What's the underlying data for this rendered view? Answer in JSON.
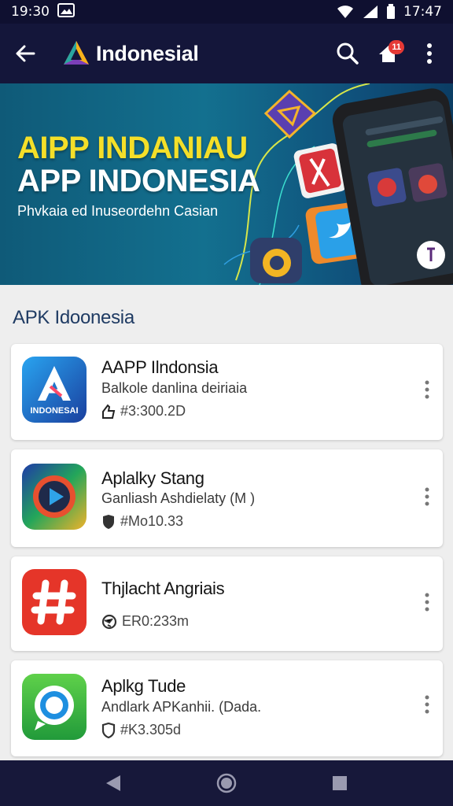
{
  "status_bar": {
    "time_left": "19:30",
    "time_right": "17:47",
    "icons": [
      "gallery-icon",
      "wifi-icon",
      "signal-icon",
      "battery-icon"
    ]
  },
  "app_bar": {
    "title": "Indonesial",
    "icons": [
      "back-arrow-icon",
      "app-logo-icon",
      "search-icon",
      "notification-icon",
      "more-vert-icon"
    ],
    "notification_count": "11"
  },
  "banner": {
    "title_line1": "AIPP INDANIAU",
    "title_line2": "APP INDONESIA",
    "subtitle": "Phvkaia ed Inuseordehn Casian",
    "colors": {
      "title_accent": "#f4df29",
      "background": "#13708f"
    }
  },
  "section": {
    "title": "APK Idoonesia"
  },
  "apps": [
    {
      "name": "AAPP Ilndonsia",
      "desc": "Balkole danlina deiriaia",
      "meta": "#3:300.2D",
      "icon_label": "INDONESAI",
      "icon": "a-logo-icon",
      "meta_icon": "thumb-icon"
    },
    {
      "name": "Aplalky Stang",
      "desc": "Ganliash Ashdielaty (M )",
      "meta": "#Mo10.33",
      "icon": "play-icon",
      "meta_icon": "shield-icon"
    },
    {
      "name": "Thjlacht Angriais",
      "desc": "",
      "meta": "ER0:233m",
      "icon": "hash-icon",
      "meta_icon": "globe-icon"
    },
    {
      "name": "Aplkg Tude",
      "desc": "Andlark APKanhii. (Dada.",
      "meta": "#K3.305d",
      "icon": "chat-icon",
      "meta_icon": "shield-icon"
    }
  ],
  "nav_bar": {
    "icons": [
      "back-triangle-icon",
      "home-circle-icon",
      "recents-square-icon"
    ]
  }
}
